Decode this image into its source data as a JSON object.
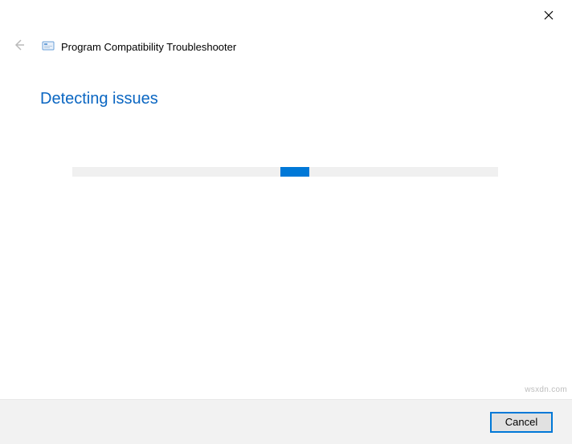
{
  "window": {
    "title": "Program Compatibility Troubleshooter",
    "close_label": "Close"
  },
  "main": {
    "heading": "Detecting issues",
    "progress": {
      "track_color": "#f0f0f0",
      "chunk_color": "#0078d7",
      "state": "indeterminate"
    }
  },
  "footer": {
    "cancel_label": "Cancel"
  },
  "watermark": "wsxdn.com",
  "icons": {
    "back": "back-arrow",
    "app": "compatibility-troubleshooter",
    "close": "close-x"
  },
  "colors": {
    "accent": "#0078d7",
    "heading": "#0a66c2",
    "footer_bg": "#f2f2f2"
  }
}
